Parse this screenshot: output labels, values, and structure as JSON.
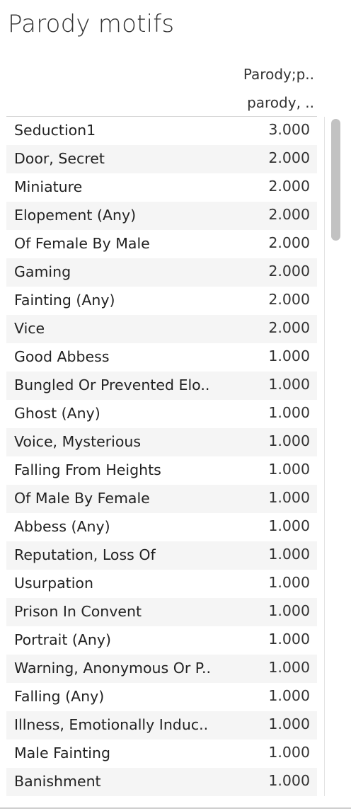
{
  "title": "Parody motifs",
  "column_header": {
    "line1": "Parody;p..",
    "line2": "parody, .."
  },
  "chart_data": {
    "type": "table",
    "title": "Parody motifs",
    "column_header": [
      "Parody;p..",
      "parody, .."
    ],
    "rows": [
      {
        "label": "Seduction1",
        "value": "3.000"
      },
      {
        "label": "Door, Secret",
        "value": "2.000"
      },
      {
        "label": "Miniature",
        "value": "2.000"
      },
      {
        "label": "Elopement (Any)",
        "value": "2.000"
      },
      {
        "label": "Of Female By Male",
        "value": "2.000"
      },
      {
        "label": "Gaming",
        "value": "2.000"
      },
      {
        "label": "Fainting (Any)",
        "value": "2.000"
      },
      {
        "label": "Vice",
        "value": "2.000"
      },
      {
        "label": "Good Abbess",
        "value": "1.000"
      },
      {
        "label": "Bungled Or Prevented Elo..",
        "value": "1.000"
      },
      {
        "label": "Ghost (Any)",
        "value": "1.000"
      },
      {
        "label": "Voice, Mysterious",
        "value": "1.000"
      },
      {
        "label": "Falling From Heights",
        "value": "1.000"
      },
      {
        "label": "Of Male By Female",
        "value": "1.000"
      },
      {
        "label": "Abbess (Any)",
        "value": "1.000"
      },
      {
        "label": "Reputation, Loss Of",
        "value": "1.000"
      },
      {
        "label": "Usurpation",
        "value": "1.000"
      },
      {
        "label": "Prison In Convent",
        "value": "1.000"
      },
      {
        "label": "Portrait (Any)",
        "value": "1.000"
      },
      {
        "label": "Warning, Anonymous Or P..",
        "value": "1.000"
      },
      {
        "label": "Falling (Any)",
        "value": "1.000"
      },
      {
        "label": "Illness, Emotionally Induc..",
        "value": "1.000"
      },
      {
        "label": "Male Fainting",
        "value": "1.000"
      },
      {
        "label": "Banishment",
        "value": "1.000"
      }
    ]
  },
  "colors": {
    "row_alt_background": "#f5f5f5",
    "scroll_thumb": "#c2c2c2"
  }
}
